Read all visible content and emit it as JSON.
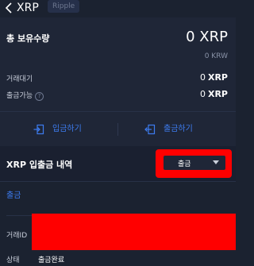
{
  "header": {
    "coin_symbol": "XRP",
    "coin_name": "Ripple"
  },
  "summary": {
    "total_label": "총 보유수량",
    "total_value": "0 XRP",
    "total_krw": "0 KRW",
    "pending_label": "거래대기",
    "pending_amount": "0",
    "pending_unit": "XRP",
    "available_label": "출금가능",
    "available_amount": "0",
    "available_unit": "XRP"
  },
  "actions": {
    "deposit_label": "입금하기",
    "withdraw_label": "출금하기"
  },
  "history": {
    "title": "XRP 입출금 내역",
    "filter_selected": "출금"
  },
  "tabs": {
    "active_label": "출금"
  },
  "detail": {
    "txid_label": "거래ID",
    "status_label": "상태",
    "status_value": "출금완료"
  },
  "colors": {
    "accent": "#3d7cf0",
    "background": "#1b2230",
    "panel": "#1f2637",
    "redaction": "#ff0000"
  }
}
